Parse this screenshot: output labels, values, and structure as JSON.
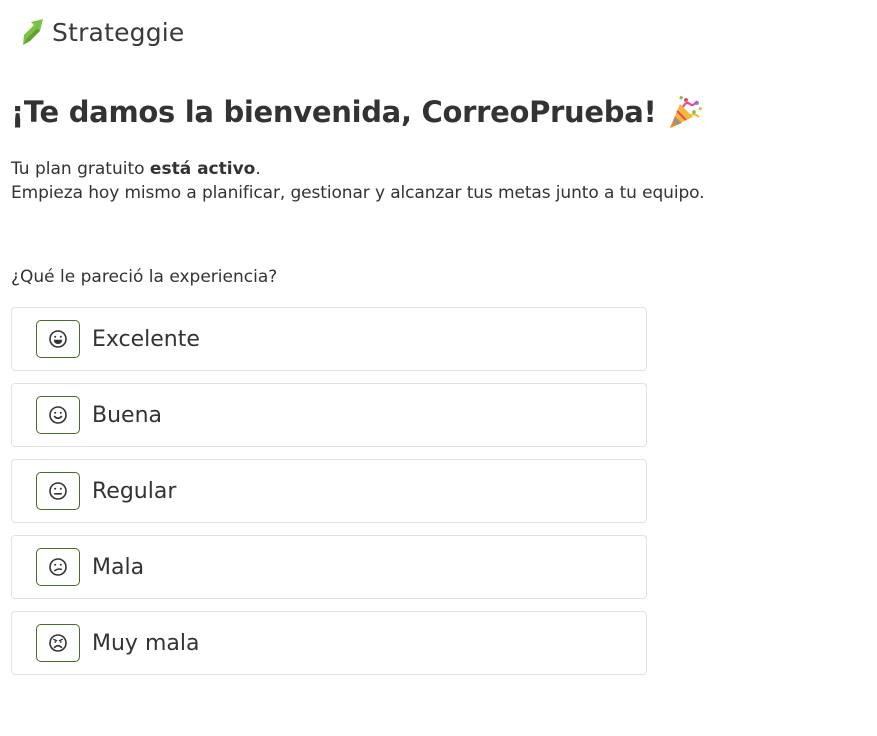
{
  "brand": {
    "name": "Strateggie",
    "accent_color": "#7dc142",
    "logo_icon": "leaf-arrow-logo"
  },
  "welcome": {
    "title": "¡Te damos la bienvenida, CorreoPrueba!",
    "title_emoji_icon": "party-popper-icon",
    "plan_prefix": "Tu plan gratuito ",
    "plan_status": "está activo",
    "plan_suffix": ".",
    "subtitle": "Empieza hoy mismo a planificar, gestionar y alcanzar tus metas junto a tu equipo."
  },
  "survey": {
    "question": "¿Qué le pareció la experiencia?",
    "icon_border_color": "#4a6a2a",
    "options": [
      {
        "label": "Excelente",
        "icon": "grinning-face-icon"
      },
      {
        "label": "Buena",
        "icon": "smiling-face-icon"
      },
      {
        "label": "Regular",
        "icon": "neutral-face-icon"
      },
      {
        "label": "Mala",
        "icon": "confused-face-icon"
      },
      {
        "label": "Muy mala",
        "icon": "angry-face-icon"
      }
    ]
  }
}
